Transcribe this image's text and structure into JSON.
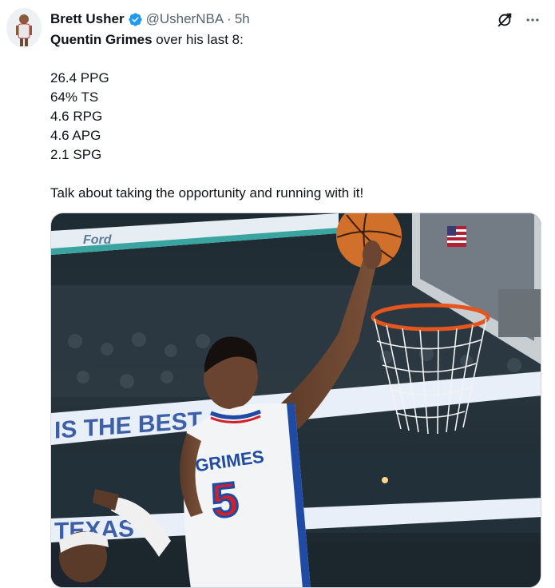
{
  "author": {
    "name": "Brett Usher",
    "handle": "@UsherNBA",
    "separator": "·",
    "time": "5h",
    "verified_color": "#1d9bf0"
  },
  "icons": {
    "avatar": "avatar-icon",
    "verified": "verified-badge-icon",
    "grok": "grok-icon",
    "more": "more-icon"
  },
  "tweet": {
    "player": "Quentin Grimes",
    "intro_rest": " over his last 8:",
    "stats": [
      "26.4 PPG",
      "64% TS",
      "4.6 RPG",
      "4.6 APG",
      "2.1 SPG"
    ],
    "closing": "Talk about taking the opportunity and running with it!"
  },
  "photo": {
    "banner_top": "IS THE BEST",
    "banner_bottom": "TEXAS",
    "jersey_name": "GRIMES",
    "jersey_number": "5",
    "sign_brand": "Ford"
  }
}
